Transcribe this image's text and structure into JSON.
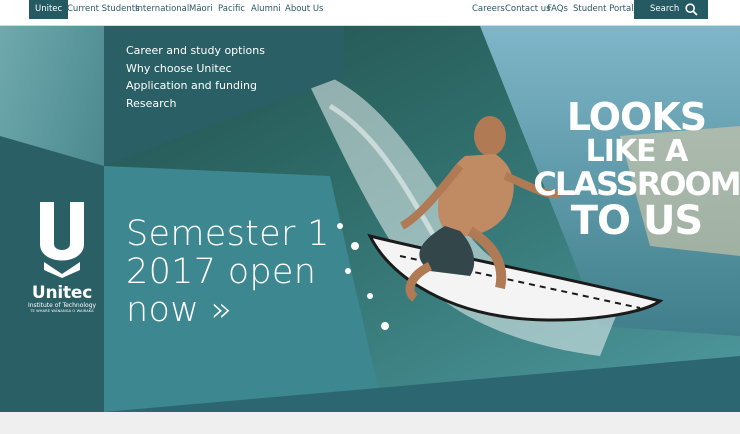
{
  "nav": {
    "left": [
      "Unitec",
      "Current Students",
      "International",
      "Māori",
      "Pacific",
      "Alumni",
      "About Us"
    ],
    "right": [
      "Careers",
      "Contact us",
      "FAQs",
      "Student Portal"
    ],
    "search_label": "Search"
  },
  "hero": {
    "menu": [
      "Career and study options",
      "Why choose Unitec",
      "Application and funding",
      "Research"
    ],
    "headline": "Semester 1 2017 open now »",
    "slogan_lines": [
      "LOOKS",
      "LIKE A",
      "CLASSROOM",
      "TO US"
    ]
  },
  "logo": {
    "name": "Unitec",
    "subtitle": "Institute of Technology",
    "maori": "TE WHARE WĀNANGA O WAIRAKA"
  },
  "colors": {
    "brand_dark": "#255a63",
    "panel_dark": "#2a5f66",
    "panel_mid": "#3d7c85",
    "accent_blue": "#1e6fd0"
  }
}
